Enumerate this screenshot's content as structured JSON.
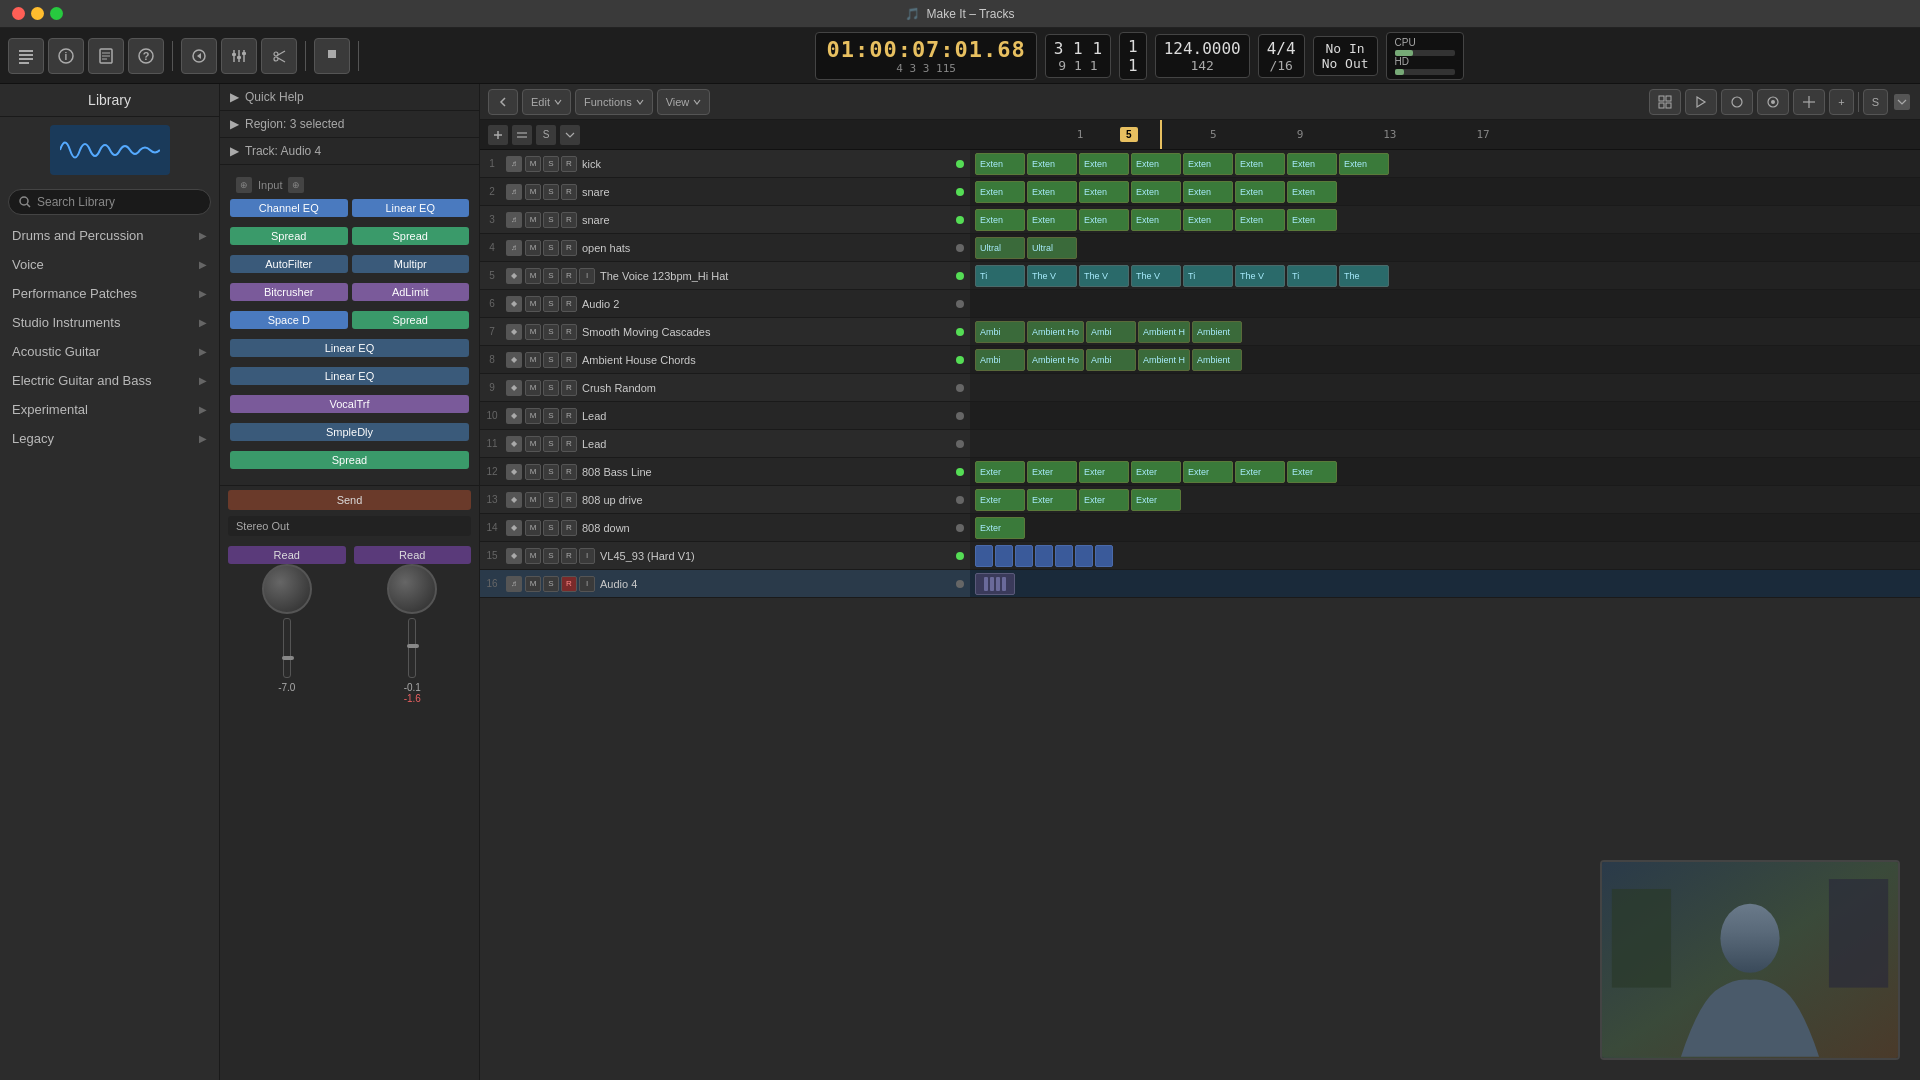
{
  "titlebar": {
    "title": "Make It – Tracks",
    "icon": "🎵"
  },
  "transport": {
    "time_main": "01:00:07:01.68",
    "time_sub": "4  3  3  115",
    "beats1": "3  1  1",
    "beats1b": "9  1  1",
    "val_1": "1",
    "val_2": "1",
    "bpm": "124.0000",
    "bpm_sub": "142",
    "time_sig": "4/4",
    "time_sig_sub": "/16",
    "no_in": "No In",
    "no_out": "No Out",
    "cpu_label": "CPU",
    "hd_label": "HD"
  },
  "library": {
    "header": "Library",
    "search_placeholder": "Search Library",
    "items": [
      {
        "label": "Drums and Percussion",
        "has_arrow": true
      },
      {
        "label": "Voice",
        "has_arrow": true
      },
      {
        "label": "Performance Patches",
        "has_arrow": true
      },
      {
        "label": "Studio Instruments",
        "has_arrow": true
      },
      {
        "label": "Acoustic Guitar",
        "has_arrow": true
      },
      {
        "label": "Electric Guitar and Bass",
        "has_arrow": true
      },
      {
        "label": "Experimental",
        "has_arrow": true
      },
      {
        "label": "Legacy",
        "has_arrow": true
      }
    ]
  },
  "quickhelp": {
    "label": "Quick Help",
    "region": "Region: 3 selected",
    "track": "Track:  Audio 4"
  },
  "plugins": {
    "left": [
      "Channel EQ",
      "Spread",
      "AutoFilter",
      "Bitcrusher",
      "Space D",
      "Linear EQ",
      "Linear EQ",
      "VocalTrf",
      "SmpleDly",
      "Spread"
    ],
    "right": [
      "Linear EQ",
      "Spread",
      "Multipr",
      "AdLimit",
      "Spread"
    ]
  },
  "io": {
    "input_label": "Input",
    "send_label": "Send",
    "stereo_out": "Stereo Out",
    "read_left": "Read",
    "read_right": "Read",
    "vol_left": "-7.0",
    "vol_right": "-0.1",
    "pan_right": "-1.6"
  },
  "toolbar": {
    "edit_label": "Edit",
    "functions_label": "Functions",
    "view_label": "View",
    "add_track": "+",
    "loop_btn": "S"
  },
  "tracks": [
    {
      "num": 1,
      "type": "audio",
      "name": "kick",
      "m": "M",
      "s": "S",
      "r": "R",
      "active": true,
      "clips": [
        "Exten",
        "Exten",
        "Exten",
        "Exten",
        "Exten",
        "Exten",
        "Exten",
        "Exten"
      ]
    },
    {
      "num": 2,
      "type": "audio",
      "name": "snare",
      "m": "M",
      "s": "S",
      "r": "R",
      "active": true,
      "clips": [
        "Exten",
        "Exten",
        "Exten",
        "Exten",
        "Exten",
        "Exten",
        "Exten"
      ]
    },
    {
      "num": 3,
      "type": "audio",
      "name": "snare",
      "m": "M",
      "s": "S",
      "r": "R",
      "active": true,
      "clips": [
        "Exten",
        "Exten",
        "Exten",
        "Exten",
        "Exten",
        "Exten",
        "Exten"
      ]
    },
    {
      "num": 4,
      "type": "audio",
      "name": "open hats",
      "m": "M",
      "s": "S",
      "r": "R",
      "active": false,
      "clips": [
        "Ultral",
        "",
        "",
        "",
        "Ultral",
        "",
        ""
      ]
    },
    {
      "num": 5,
      "type": "midi",
      "name": "The Voice 123bpm_Hi Hat",
      "m": "M",
      "s": "S",
      "r": "R",
      "i": "I",
      "active": true,
      "clips": [
        "Ti",
        "The V",
        "The V",
        "The V",
        "Ti",
        "The V",
        "Ti",
        "The"
      ]
    },
    {
      "num": 6,
      "type": "midi",
      "name": "Audio 2",
      "m": "M",
      "s": "S",
      "r": "R",
      "active": false,
      "clips": []
    },
    {
      "num": 7,
      "type": "midi",
      "name": "Smooth Moving Cascades",
      "m": "M",
      "s": "S",
      "r": "R",
      "active": true,
      "clips": [
        "Ambi",
        "Ambient Ho",
        "Ambi",
        "Ambient H",
        "Ambient"
      ]
    },
    {
      "num": 8,
      "type": "midi",
      "name": "Ambient House Chords",
      "m": "M",
      "s": "S",
      "r": "R",
      "active": true,
      "clips": [
        "Ambi",
        "Ambient Ho",
        "Ambi",
        "Ambient H",
        "Ambient"
      ]
    },
    {
      "num": 9,
      "type": "midi",
      "name": "Crush Random",
      "m": "M",
      "s": "S",
      "r": "R",
      "active": false,
      "clips": []
    },
    {
      "num": 10,
      "type": "midi",
      "name": "Lead",
      "m": "M",
      "s": "S",
      "r": "R",
      "active": false,
      "clips": []
    },
    {
      "num": 11,
      "type": "midi",
      "name": "Lead",
      "m": "M",
      "s": "S",
      "r": "R",
      "active": false,
      "clips": []
    },
    {
      "num": 12,
      "type": "midi",
      "name": "808 Bass Line",
      "m": "M",
      "s": "S",
      "r": "R",
      "active": true,
      "clips": [
        "Exter",
        "Exter",
        "Exter",
        "Exter",
        "Exter",
        "Exter",
        "Exter"
      ]
    },
    {
      "num": 13,
      "type": "midi",
      "name": "808 up drive",
      "m": "M",
      "s": "S",
      "r": "R",
      "active": false,
      "clips": [
        "Exter",
        "Exter",
        "Exter",
        "Exter"
      ]
    },
    {
      "num": 14,
      "type": "midi",
      "name": "808 down",
      "m": "M",
      "s": "S",
      "r": "R",
      "active": false,
      "clips": [
        "Exter"
      ]
    },
    {
      "num": 15,
      "type": "midi",
      "name": "VL45_93 (Hard V1)",
      "m": "M",
      "s": "S",
      "r": "R",
      "i": "I",
      "active": true,
      "clips": []
    },
    {
      "num": 16,
      "type": "audio",
      "name": "Audio 4",
      "m": "M",
      "s": "S",
      "r": "R",
      "i": "I",
      "active": false,
      "clips": [],
      "selected": true
    }
  ],
  "ruler": {
    "marks": [
      "1",
      "5",
      "9",
      "13",
      "17"
    ]
  },
  "colors": {
    "accent": "#e8c060",
    "green_clip": "#3a7a3a",
    "teal_clip": "#2a6a6a",
    "blue_clip": "#2a4a7a",
    "toolbar_bg": "#2a2a2a",
    "sidebar_bg": "#2c2c2c"
  }
}
